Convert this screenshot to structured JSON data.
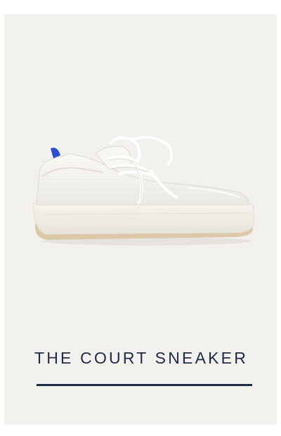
{
  "product": {
    "name": "THE COURT SNEAKER",
    "image_alt": "White knit court sneaker with white laces and a cream sole",
    "colors": {
      "card_background": "#f2f1ee",
      "title_text": "#1f2a44",
      "shoe_upper": "#f7f6f2",
      "sole": "#f0ece3",
      "sole_bottom": "#dcc7a8",
      "heel_tab": "#2d4fd1"
    }
  }
}
